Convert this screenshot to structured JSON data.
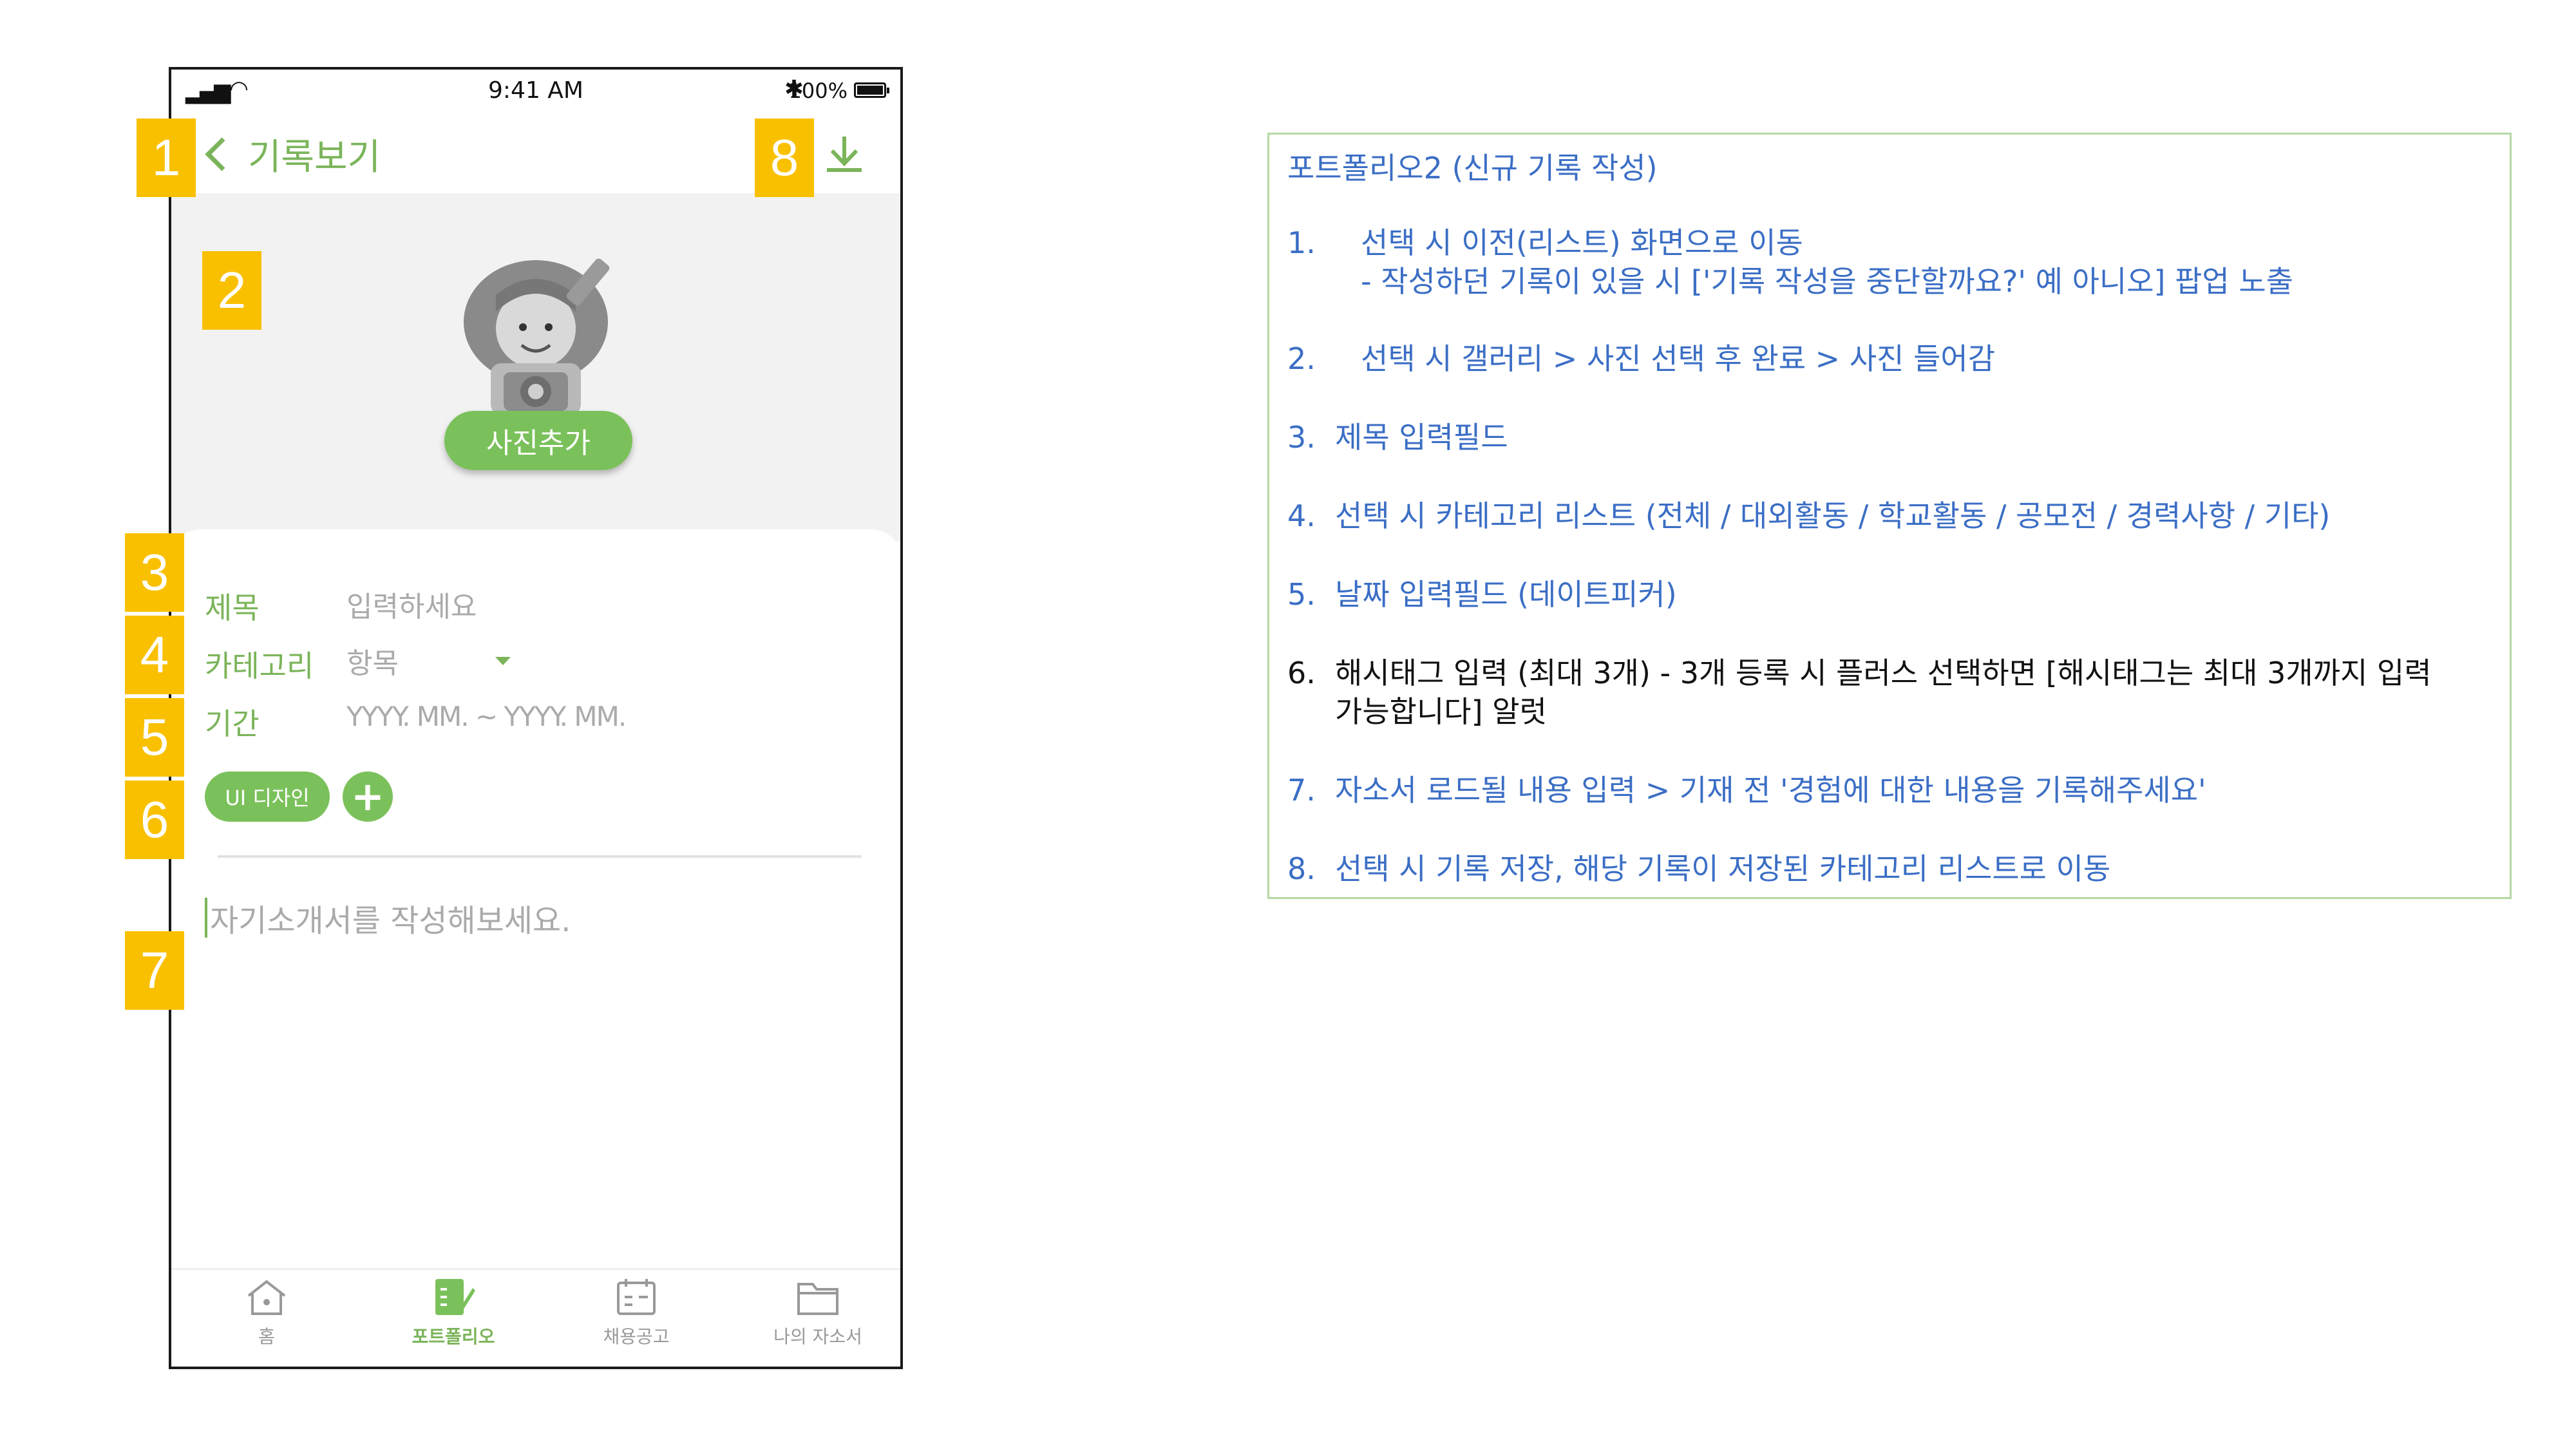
{
  "status_bar": {
    "time": "9:41 AM",
    "battery": "100%",
    "signal": "▂▄▆",
    "wifi": "◠",
    "bluetooth": "✱"
  },
  "header": {
    "back_label": "기록보기",
    "save_icon": "download-icon"
  },
  "photo": {
    "add_label": "사진추가"
  },
  "form": {
    "title_label": "제목",
    "title_placeholder": "입력하세요",
    "category_label": "카테고리",
    "category_value": "항목",
    "period_label": "기간",
    "period_placeholder": "YYYY. MM. ~ YYYY. MM.",
    "hashtag": "UI 디자인",
    "hashtag_add": "+",
    "intro_placeholder": "자기소개서를 작성해보세요."
  },
  "tabbar": {
    "items": [
      {
        "label": "홈",
        "icon": "home-icon"
      },
      {
        "label": "포트폴리오",
        "icon": "portfolio-icon",
        "active": true
      },
      {
        "label": "채용공고",
        "icon": "calendar-icon"
      },
      {
        "label": "나의 자소서",
        "icon": "folder-icon"
      }
    ]
  },
  "markers": [
    "1",
    "2",
    "3",
    "4",
    "5",
    "6",
    "7",
    "8"
  ],
  "description": {
    "title": "포트폴리오2 (신규 기록 작성)",
    "items": [
      {
        "num": "1.",
        "lines": [
          "선택 시 이전(리스트) 화면으로 이동",
          "- 작성하던 기록이 있을 시 ['기록 작성을 중단할까요?' 예 아니오] 팝업 노출"
        ]
      },
      {
        "num": "2.",
        "lines": [
          "선택 시 갤러리 > 사진 선택 후 완료 > 사진 들어감"
        ]
      },
      {
        "num": "3.",
        "lines": [
          "제목 입력필드"
        ]
      },
      {
        "num": "4.",
        "lines": [
          "선택 시 카테고리 리스트 (전체 / 대외활동 / 학교활동 / 공모전 / 경력사항 / 기타)"
        ]
      },
      {
        "num": "5.",
        "lines": [
          "날짜 입력필드 (데이트피커)"
        ]
      },
      {
        "num": "6.",
        "lines": [
          "해시태그 입력 (최대 3개) - 3개 등록 시 플러스 선택하면 [해시태그는 최대 3개까지 입력",
          "가능합니다] 알럿"
        ]
      },
      {
        "num": "7.",
        "lines": [
          "자소서 로드될 내용 입력 > 기재 전 '경험에 대한 내용을 기록해주세요'"
        ]
      },
      {
        "num": "8.",
        "lines": [
          "선택 시 기록 저장, 해당 기록이 저장된 카테고리 리스트로 이동"
        ]
      }
    ]
  },
  "colors": {
    "accent": "#7bc15b",
    "marker": "#f9c000",
    "desc_text": "#3b6ec5",
    "panel_border": "#b5d8a3"
  }
}
